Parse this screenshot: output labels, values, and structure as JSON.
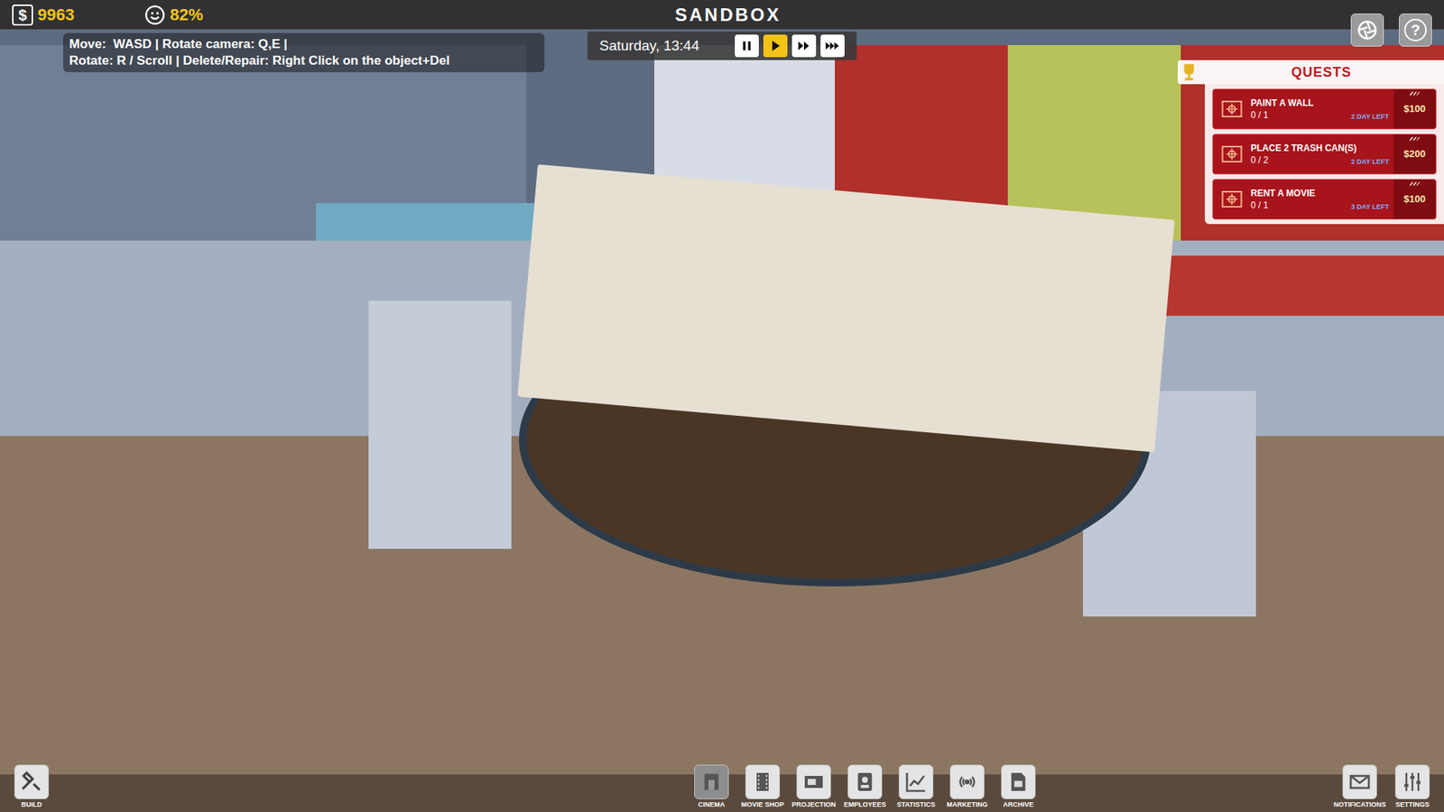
{
  "top_bar": {
    "money_icon": "$",
    "money": "9963",
    "happiness": "82%",
    "title": "SANDBOX",
    "help_icon": "?"
  },
  "help": [
    "Move:  WASD | Rotate camera: Q,E |",
    "Rotate: R / Scroll | Delete/Repair: Right Click on the object+Del"
  ],
  "clock": {
    "time": "Saturday, 13:44",
    "speeds": [
      {
        "kind": "pause",
        "selected": false
      },
      {
        "kind": "play",
        "selected": true
      },
      {
        "kind": "fast",
        "selected": false
      },
      {
        "kind": "faster",
        "selected": false
      }
    ]
  },
  "quests": {
    "title": "QUESTS",
    "items": [
      {
        "title": "PAINT A WALL",
        "progress": "0 / 1",
        "time_left": "2 DAY LEFT",
        "reward": "$100"
      },
      {
        "title": "PLACE 2 TRASH CAN(S)",
        "progress": "0 / 2",
        "time_left": "2 DAY LEFT",
        "reward": "$200"
      },
      {
        "title": "RENT A MOVIE",
        "progress": "0 / 1",
        "time_left": "3 DAY LEFT",
        "reward": "$100"
      }
    ]
  },
  "toolbar": {
    "left": [
      {
        "label": "BUILD",
        "kind": "build",
        "selected": false
      }
    ],
    "center": [
      {
        "label": "CINEMA",
        "kind": "cinema",
        "selected": true
      },
      {
        "label": "MOVIE SHOP",
        "kind": "film",
        "selected": false
      },
      {
        "label": "PROJECTION",
        "kind": "projection",
        "selected": false
      },
      {
        "label": "EMPLOYEES",
        "kind": "employees",
        "selected": false
      },
      {
        "label": "STATISTICS",
        "kind": "statistics",
        "selected": false
      },
      {
        "label": "MARKETING",
        "kind": "marketing",
        "selected": false
      },
      {
        "label": "ARCHIVE",
        "kind": "archive",
        "selected": false
      }
    ],
    "right": [
      {
        "label": "NOTIFICATIONS",
        "kind": "mail",
        "selected": false
      },
      {
        "label": "SETTINGS",
        "kind": "settings",
        "selected": false
      }
    ]
  }
}
